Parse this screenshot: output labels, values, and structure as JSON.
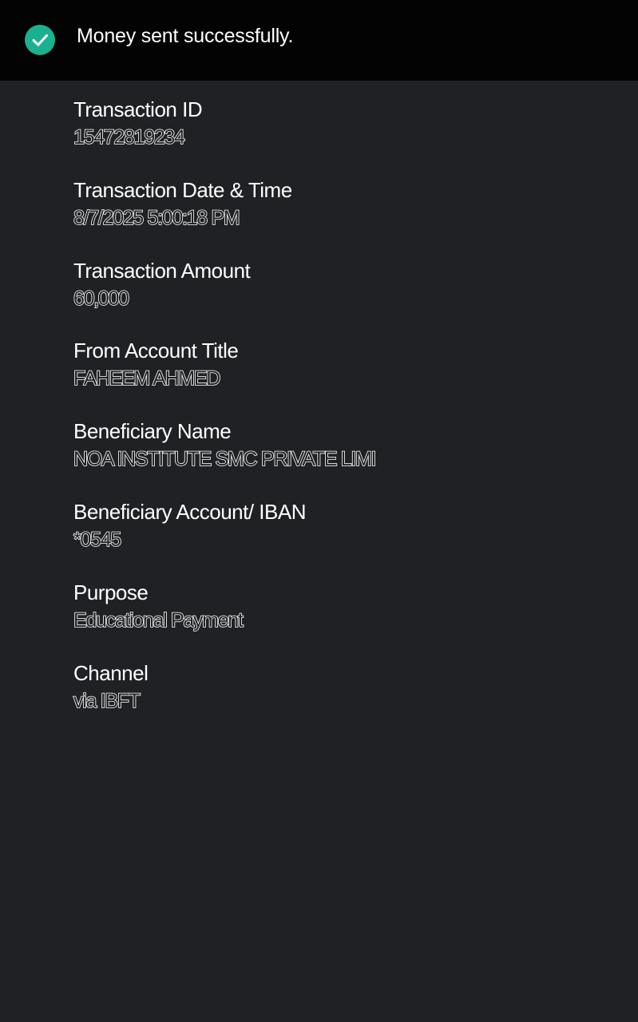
{
  "banner": {
    "icon": "check-circle-icon",
    "accent_color": "#1bb08f",
    "message": "Money sent successfully."
  },
  "details": [
    {
      "label": "Transaction ID",
      "value": "15472819234"
    },
    {
      "label": "Transaction Date & Time",
      "value": "8/7/2025 5:00:18 PM"
    },
    {
      "label": "Transaction Amount",
      "value": "60,000"
    },
    {
      "label": "From Account Title",
      "value": "FAHEEM AHMED"
    },
    {
      "label": "Beneficiary Name",
      "value": "NOA INSTITUTE SMC PRIVATE LIMI"
    },
    {
      "label": "Beneficiary Account/ IBAN",
      "value": "*0545"
    },
    {
      "label": "Purpose",
      "value": "Educational Payment"
    },
    {
      "label": "Channel",
      "value": "via IBFT"
    }
  ]
}
